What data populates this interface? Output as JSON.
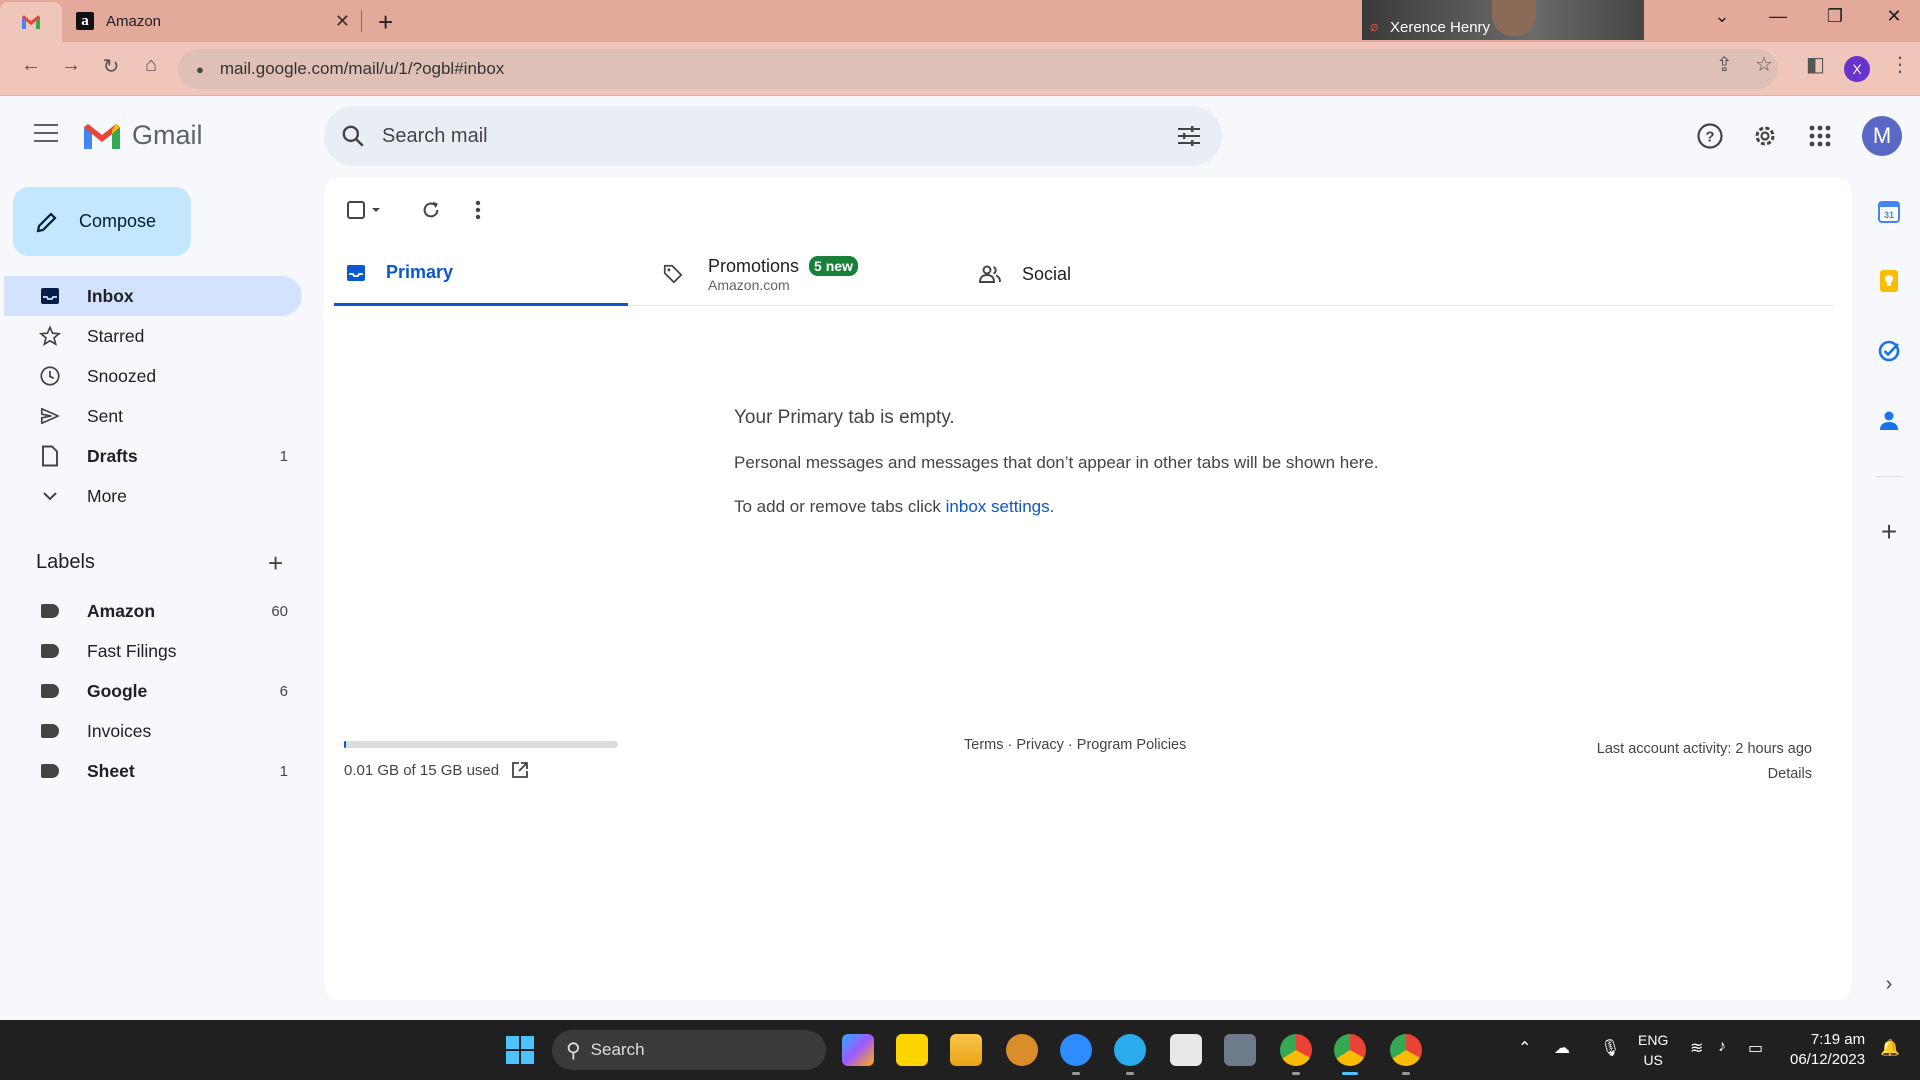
{
  "browser": {
    "tabs": [
      {
        "label": "",
        "favicon": "gmail-icon"
      },
      {
        "label": "Amazon",
        "favicon": "amazon-icon"
      }
    ],
    "url": "mail.google.com/mail/u/1/?ogbl#inbox",
    "profile_initial": "X",
    "video_participant": "Xerence Henry"
  },
  "gmail": {
    "logo_text": "Gmail",
    "search_placeholder": "Search mail",
    "avatar_initial": "M",
    "compose_label": "Compose",
    "nav": [
      {
        "label": "Inbox",
        "count": "",
        "icon": "inbox-icon",
        "active": true,
        "bold": true
      },
      {
        "label": "Starred",
        "count": "",
        "icon": "star-icon"
      },
      {
        "label": "Snoozed",
        "count": "",
        "icon": "clock-icon"
      },
      {
        "label": "Sent",
        "count": "",
        "icon": "send-icon"
      },
      {
        "label": "Drafts",
        "count": "1",
        "icon": "draft-icon",
        "bold": true
      },
      {
        "label": "More",
        "count": "",
        "icon": "chevron-down-icon"
      }
    ],
    "labels_heading": "Labels",
    "labels": [
      {
        "label": "Amazon",
        "count": "60",
        "bold": true
      },
      {
        "label": "Fast Filings",
        "count": ""
      },
      {
        "label": "Google",
        "count": "6",
        "bold": true
      },
      {
        "label": "Invoices",
        "count": ""
      },
      {
        "label": "Sheet",
        "count": "1",
        "bold": true
      }
    ],
    "tabs": [
      {
        "label": "Primary"
      },
      {
        "label": "Promotions",
        "badge": "5 new",
        "sub": "Amazon.com"
      },
      {
        "label": "Social"
      }
    ],
    "empty": {
      "heading": "Your Primary tab is empty.",
      "line1": "Personal messages and messages that don’t appear in other tabs will be shown here.",
      "line2_prefix": "To add or remove tabs click ",
      "line2_link": "inbox settings",
      "line2_suffix": "."
    },
    "footer": {
      "storage": "0.01 GB of 15 GB used",
      "storage_fraction": 0.0007,
      "links": "Terms · Privacy · Program Policies",
      "activity": "Last account activity: 2 hours ago",
      "details": "Details"
    }
  },
  "taskbar": {
    "search_label": "Search",
    "lang_top": "ENG",
    "lang_bottom": "US",
    "time": "7:19 am",
    "date": "06/12/2023"
  },
  "colors": {
    "accent": "#0b57d0",
    "compose_bg": "#c2e7ff",
    "active_nav": "#d3e3fd",
    "badge_green": "#188038",
    "chrome_frame": "#e3a99a"
  }
}
